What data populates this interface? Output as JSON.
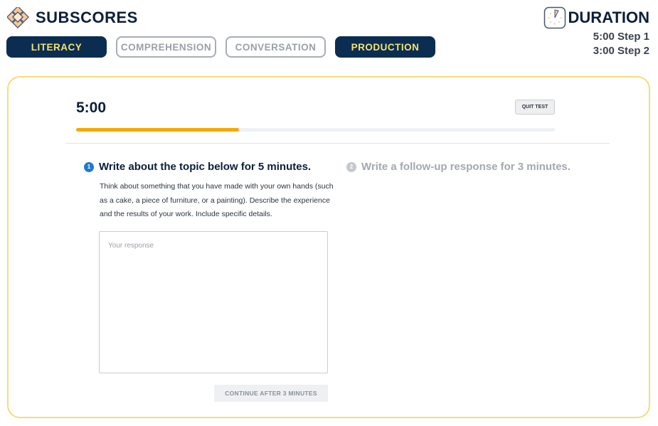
{
  "header": {
    "title": "SUBSCORES",
    "logo_icon": "diamond-grid-icon"
  },
  "tabs": [
    {
      "label": "LITERACY",
      "active": true
    },
    {
      "label": "COMPREHENSION",
      "active": false
    },
    {
      "label": "CONVERSATION",
      "active": false
    },
    {
      "label": "PRODUCTION",
      "active": true
    }
  ],
  "duration": {
    "title": "DURATION",
    "icon": "clock-icon",
    "step1": "5:00 Step 1",
    "step2": "3:00 Step 2"
  },
  "test": {
    "timer": "5:00",
    "quit_label": "QUIT TEST",
    "progress_percent": 34,
    "step1": {
      "number": "1",
      "title": "Write about the topic below for 5 minutes.",
      "prompt": "Think about something that you have made with your own hands (such as a cake, a piece of furniture, or a painting). Describe the experience and the results of your work. Include specific details."
    },
    "step2": {
      "number": "2",
      "title": "Write a follow-up response for 3 minutes."
    },
    "response_placeholder": "Your response",
    "response_value": "",
    "continue_label": "CONTINUE AFTER 3 MINUTES"
  },
  "colors": {
    "navy": "#0b2d52",
    "yellow": "#f7e36a",
    "progress": "#f6a800",
    "card_border": "#f5dc7a",
    "step_active": "#1f7ad1"
  }
}
